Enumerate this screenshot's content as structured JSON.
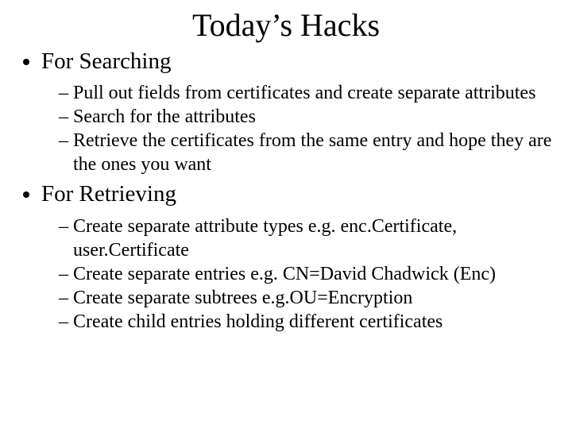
{
  "title": "Today’s Hacks",
  "sections": [
    {
      "heading": "For Searching",
      "items": [
        "Pull out fields from certificates and create separate attributes",
        "Search for the attributes",
        "Retrieve the certificates from the same entry and hope they are the ones you want"
      ]
    },
    {
      "heading": "For Retrieving",
      "items": [
        "Create separate attribute types e.g. enc.Certificate, user.Certificate",
        "Create separate entries e.g. CN=David Chadwick (Enc)",
        "Create separate subtrees e.g.OU=Encryption",
        "Create child entries holding different certificates"
      ]
    }
  ],
  "dash": "– "
}
